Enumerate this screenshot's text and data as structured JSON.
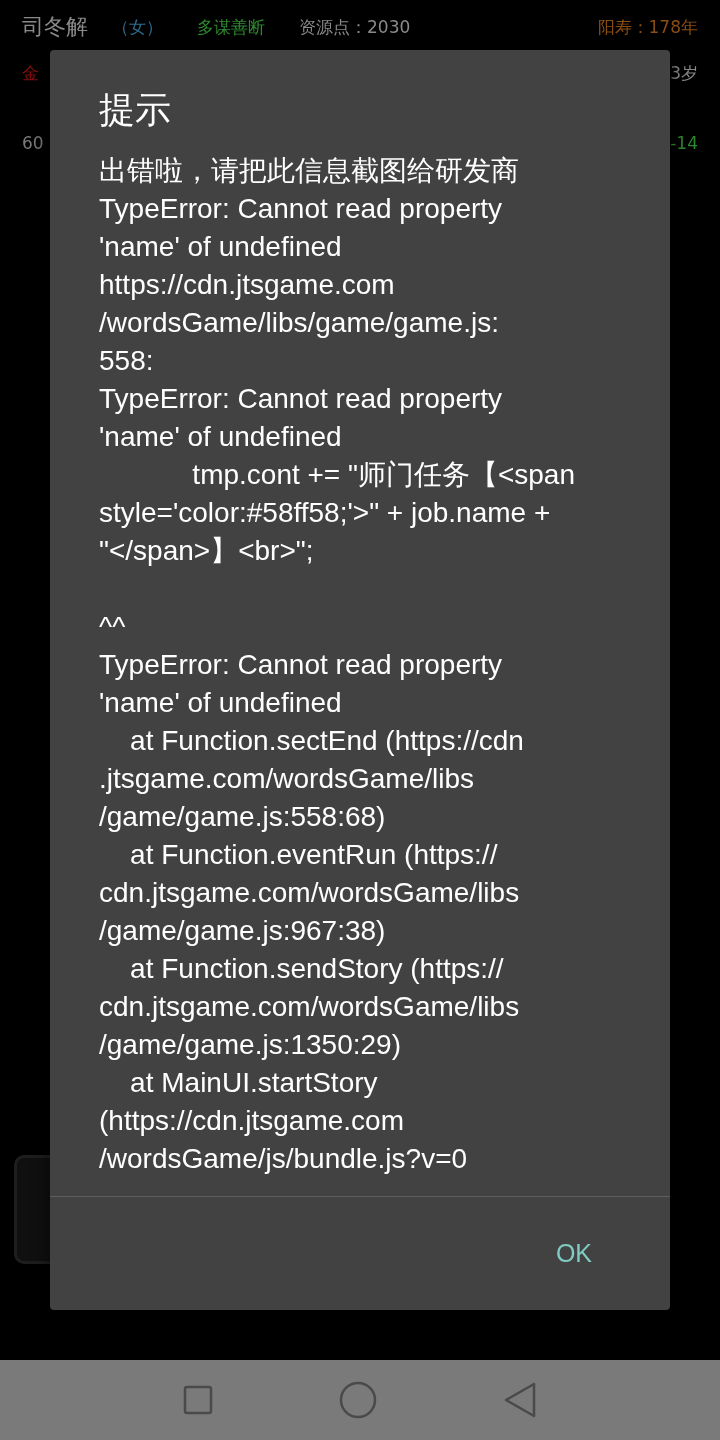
{
  "status_rows": [
    {
      "left": [
        {
          "text": "司冬解",
          "color": "#8a8a8a",
          "kind": "name"
        },
        {
          "text": "（女）",
          "color": "#2e6d8e",
          "kind": "stat"
        },
        {
          "text": "多谋善断",
          "color": "#2f8a2f",
          "kind": "stat"
        },
        {
          "text": "资源点：2030",
          "color": "#8a8a8a",
          "kind": "stat"
        }
      ],
      "right": [
        {
          "text": "阳寿：178年",
          "color": "#8a4d12",
          "kind": "stat"
        }
      ]
    },
    {
      "left": [
        {
          "text": "金",
          "color": "#8a1010",
          "kind": "stat"
        }
      ],
      "right": [
        {
          "text": "3岁",
          "color": "#8a8a8a",
          "kind": "stat"
        }
      ]
    },
    {
      "left": [
        {
          "text": "60",
          "color": "#7a7a7a",
          "kind": "stat"
        }
      ],
      "right": [
        {
          "text": "-14",
          "color": "#2f8a2f",
          "kind": "stat"
        }
      ]
    }
  ],
  "dialog": {
    "title": "提示",
    "message": "出错啦，请把此信息截图给研发商\nTypeError: Cannot read property\n'name' of undefined\nhttps://cdn.jtsgame.com\n/wordsGame/libs/game/game.js:\n558:\nTypeError: Cannot read property\n'name' of undefined\n            tmp.cont += \"师门任务【<span\nstyle='color:#58ff58;'>\" + job.name +\n\"</span>】<br>\";\n\n^^\nTypeError: Cannot read property\n'name' of undefined\n    at Function.sectEnd (https://cdn\n.jtsgame.com/wordsGame/libs\n/game/game.js:558:68)\n    at Function.eventRun (https://\ncdn.jtsgame.com/wordsGame/libs\n/game/game.js:967:38)\n    at Function.sendStory (https://\ncdn.jtsgame.com/wordsGame/libs\n/game/game.js:1350:29)\n    at MainUI.startStory\n(https://cdn.jtsgame.com\n/wordsGame/js/bundle.js?v=0",
    "buttons": [
      "OK"
    ]
  }
}
